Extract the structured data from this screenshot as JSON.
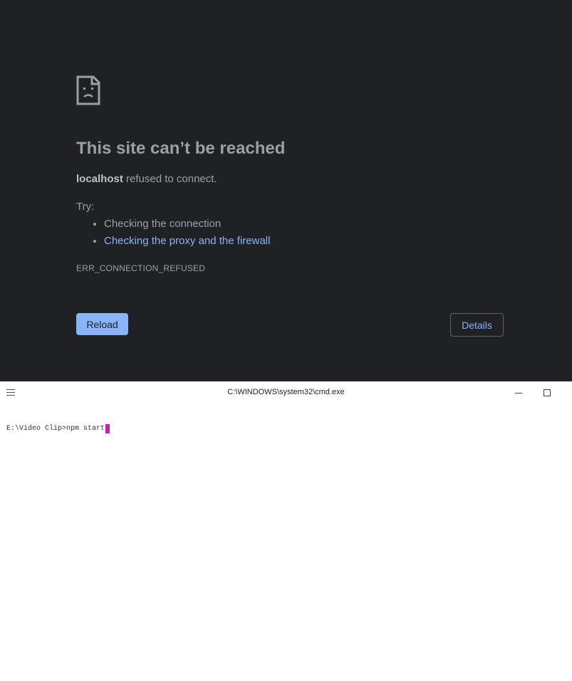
{
  "browser": {
    "error_icon": "sad-page-icon",
    "title": "This site can’t be reached",
    "host": "localhost",
    "description_suffix": " refused to connect.",
    "try_label": "Try:",
    "suggestions": [
      "Checking the connection",
      "Checking the proxy and the firewall"
    ],
    "error_code": "ERR_CONNECTION_REFUSED",
    "reload_label": "Reload",
    "details_label": "Details",
    "colors": {
      "background": "#202124",
      "accent": "#8ab4f8",
      "text": "#9aa0a6"
    }
  },
  "console": {
    "menu_icon": "hamburger-menu-icon",
    "title": "C:\\WINDOWS\\system32\\cmd.exe",
    "prompt": "E:\\Video Clip>npm start",
    "cursor_color": "#c020c0"
  }
}
